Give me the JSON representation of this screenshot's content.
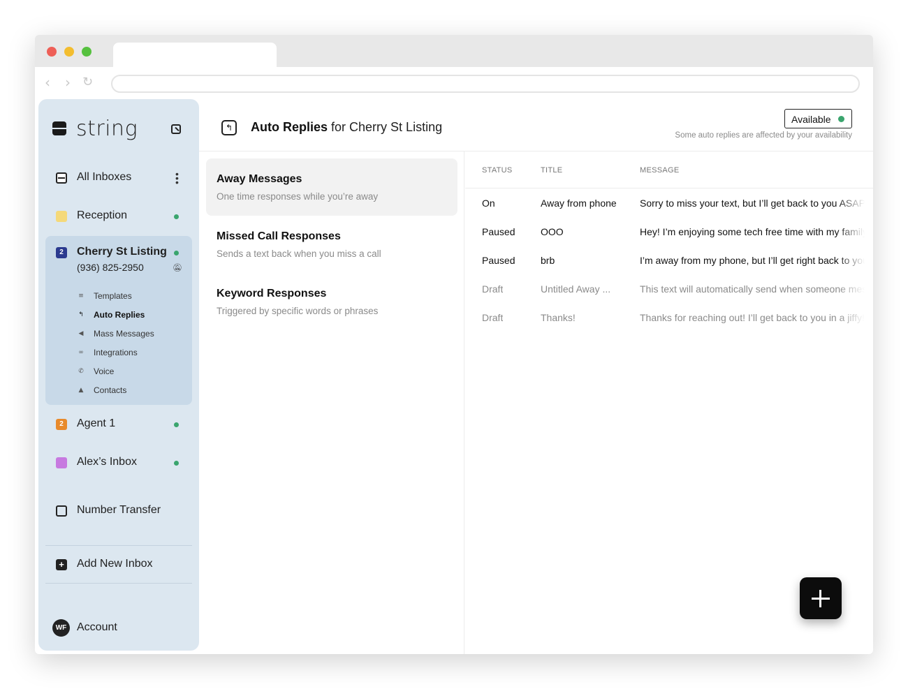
{
  "app": {
    "brand": "string"
  },
  "sidebar": {
    "all_inboxes": "All Inboxes",
    "inboxes": [
      {
        "label": "Reception",
        "color": "#f5d97a"
      },
      {
        "label": "Cherry St Listing",
        "badge": "2",
        "badge_color": "#2b3a8f",
        "phone": "(936) 825-2950"
      },
      {
        "label": "Agent 1",
        "badge": "2",
        "badge_color": "#e88a2b"
      },
      {
        "label": "Alex’s Inbox",
        "color": "#c77ae0"
      }
    ],
    "sub_items": [
      {
        "label": "Templates",
        "icon": "list-icon"
      },
      {
        "label": "Auto Replies",
        "icon": "reply-icon"
      },
      {
        "label": "Mass Messages",
        "icon": "megaphone-icon"
      },
      {
        "label": "Integrations",
        "icon": "link-icon"
      },
      {
        "label": "Voice",
        "icon": "phone-icon"
      },
      {
        "label": "Contacts",
        "icon": "person-icon"
      }
    ],
    "number_transfer": "Number Transfer",
    "add_new_inbox": "Add New Inbox",
    "account": "Account",
    "account_initials": "WF"
  },
  "header": {
    "title_bold": "Auto Replies",
    "title_rest": "for Cherry St Listing",
    "availability_label": "Available",
    "availability_note": "Some auto replies are affected by your availability"
  },
  "categories": [
    {
      "title": "Away Messages",
      "subtitle": "One time responses while you’re away"
    },
    {
      "title": "Missed Call Responses",
      "subtitle": "Sends a text back when you miss a call"
    },
    {
      "title": "Keyword Responses",
      "subtitle": "Triggered by specific words or phrases"
    }
  ],
  "table": {
    "headers": {
      "status": "STATUS",
      "title": "TITLE",
      "message": "MESSAGE"
    },
    "rows": [
      {
        "status": "On",
        "title": "Away from phone",
        "message": "Sorry to miss your text, but I’ll get back to you ASAP"
      },
      {
        "status": "Paused",
        "title": "OOO",
        "message": "Hey! I’m enjoying some tech free time with my family"
      },
      {
        "status": "Paused",
        "title": "brb",
        "message": "I’m away from my phone, but I’ll get right back to you"
      },
      {
        "status": "Draft",
        "title": "Untitled Away ...",
        "message": "This text will automatically send when someone messages"
      },
      {
        "status": "Draft",
        "title": "Thanks!",
        "message": "Thanks for reaching out! I’ll get back to you in a jiffy!"
      }
    ]
  },
  "colors": {
    "sidebar_bg": "#dce7f0",
    "selected_bg": "#c8d9e8",
    "status_green": "#3aa56e"
  }
}
